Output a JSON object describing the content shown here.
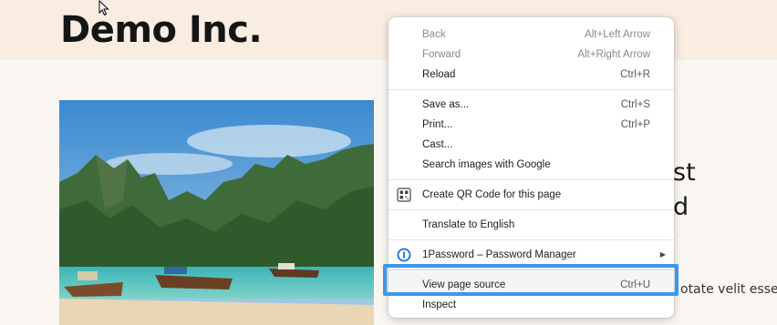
{
  "site": {
    "title": "Demo Inc.",
    "heading_fragment_1": "st",
    "heading_fragment_2": "d",
    "body_fragment": "otate velit esse c"
  },
  "context_menu": {
    "items": [
      {
        "label": "Back",
        "shortcut": "Alt+Left Arrow",
        "disabled": true
      },
      {
        "label": "Forward",
        "shortcut": "Alt+Right Arrow",
        "disabled": true
      },
      {
        "label": "Reload",
        "shortcut": "Ctrl+R",
        "disabled": false
      },
      {
        "label": "Save as...",
        "shortcut": "Ctrl+S",
        "disabled": false
      },
      {
        "label": "Print...",
        "shortcut": "Ctrl+P",
        "disabled": false
      },
      {
        "label": "Cast...",
        "shortcut": "",
        "disabled": false
      },
      {
        "label": "Search images with Google",
        "shortcut": "",
        "disabled": false
      },
      {
        "label": "Create QR Code for this page",
        "shortcut": "",
        "icon": "qr-code-icon"
      },
      {
        "label": "Translate to English",
        "shortcut": ""
      },
      {
        "label": "1Password – Password Manager",
        "shortcut": "",
        "icon": "1password-icon",
        "has_submenu": true
      },
      {
        "label": "View page source",
        "shortcut": "Ctrl+U",
        "highlighted": true
      },
      {
        "label": "Inspect",
        "shortcut": ""
      }
    ]
  },
  "colors": {
    "header_bg": "#f9ede2",
    "highlight_border": "#3c97ea",
    "onepassword_blue": "#1a6fe0"
  }
}
